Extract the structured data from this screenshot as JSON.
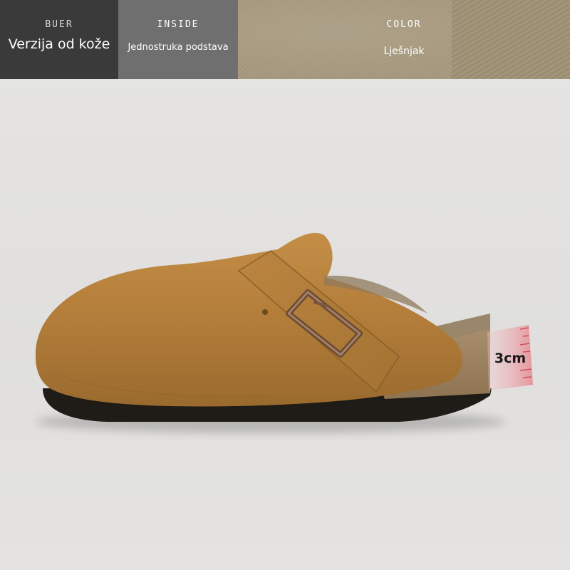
{
  "spec_bar": {
    "brand": {
      "label": "BUER",
      "value": "Verzija od kože"
    },
    "inside": {
      "label": "INSIDE",
      "value": "Jednostruka podstava"
    },
    "color": {
      "label": "COLOR",
      "value": "Lješnjak",
      "swatch_hex": "#a89a7f"
    }
  },
  "product": {
    "description": "suede clog with buckle strap and cork sole",
    "upper_color": "#b5823f",
    "sole_color": "#1f1b17",
    "heel_height_label": "3cm"
  }
}
